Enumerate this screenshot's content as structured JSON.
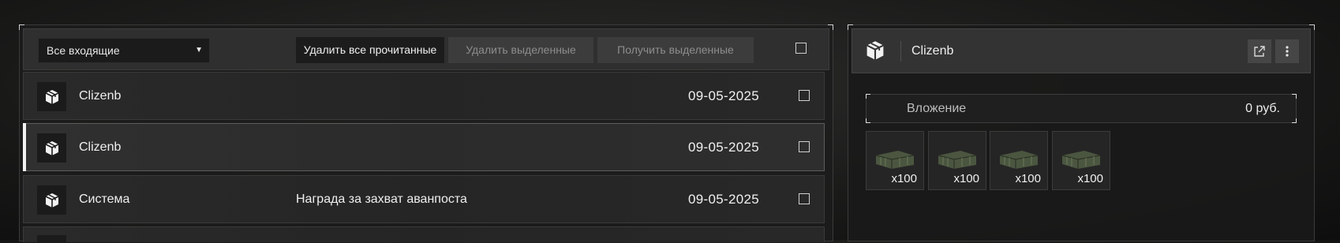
{
  "inbox": {
    "folder_select": "Все входящие",
    "delete_read_label": "Удалить все прочитанные",
    "delete_selected_label": "Удалить выделенные",
    "receive_selected_label": "Получить выделенные",
    "messages": [
      {
        "sender": "Clizenb",
        "subject": "",
        "date": "09-05-2025",
        "selected": false
      },
      {
        "sender": "Clizenb",
        "subject": "",
        "date": "09-05-2025",
        "selected": true
      },
      {
        "sender": "Система",
        "subject": "Награда за захват аванпоста",
        "date": "09-05-2025",
        "selected": false
      }
    ]
  },
  "detail": {
    "sender": "Clizenb",
    "attachment_label": "Вложение",
    "attachment_value": "0 руб.",
    "items": [
      {
        "icon": "ammo-crate-icon",
        "quantity": "x100"
      },
      {
        "icon": "ammo-crate-icon",
        "quantity": "x100"
      },
      {
        "icon": "ammo-crate-icon",
        "quantity": "x100"
      },
      {
        "icon": "ammo-crate-icon",
        "quantity": "x100"
      }
    ]
  },
  "colors": {
    "accent": "#f2f2f2",
    "panel": "#2f2f2f",
    "disabled_text": "#8d8d8d"
  }
}
